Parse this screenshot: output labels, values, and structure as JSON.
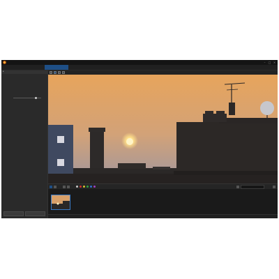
{
  "window": {
    "title": ""
  },
  "menu": {
    "items": [
      "",
      "",
      "",
      "",
      ""
    ]
  },
  "window_controls": {
    "minimize": "–",
    "maximize": "□",
    "close": "×"
  },
  "tabs": [
    "",
    "",
    "",
    "",
    "",
    ""
  ],
  "active_tab_index": 2,
  "brand": "",
  "left_panel": {
    "header": "",
    "description": "",
    "link": "",
    "note": "",
    "slider": {
      "label": "",
      "value": "",
      "level": 0.8
    },
    "buttons": [
      "",
      ""
    ]
  },
  "view_toolbar": {
    "texts": [
      "",
      "",
      ""
    ],
    "zoom": ""
  },
  "search": {
    "placeholder": ""
  },
  "status": {
    "left": "",
    "right": ""
  },
  "colors": {
    "accent": "#1e4f86",
    "sky_top": "#e3a45c",
    "sky_bottom": "#8a8a96",
    "sun": "#fff3c8",
    "silhouette": "#2b2827"
  },
  "icons": {
    "logo": "app-logo-icon",
    "view_tools": [
      "grid-view-icon",
      "single-view-icon",
      "compare-icon",
      "info-icon"
    ],
    "edit_tools": [
      "rotate-left-icon",
      "rotate-right-icon",
      "flag-icon",
      "color-label-icon"
    ]
  }
}
